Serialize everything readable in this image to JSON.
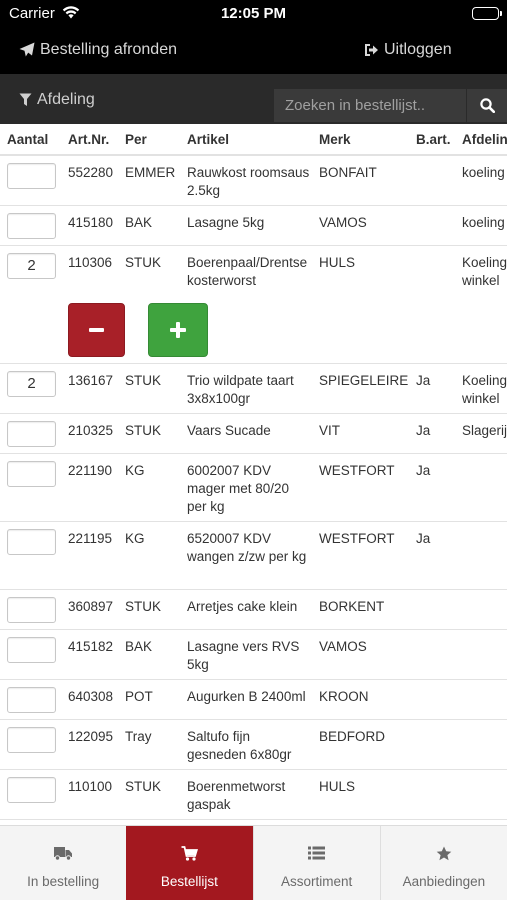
{
  "status_bar": {
    "carrier": "Carrier",
    "time": "12:05 PM"
  },
  "nav": {
    "finish_label": "Bestelling afronden",
    "logout_label": "Uitloggen"
  },
  "filter": {
    "department_label": "Afdeling",
    "search_placeholder": "Zoeken in bestellijst.."
  },
  "table": {
    "headers": {
      "aantal": "Aantal",
      "artnr": "Art.Nr.",
      "per": "Per",
      "artikel": "Artikel",
      "merk": "Merk",
      "bart": "B.art.",
      "afdeling": "Afdeling"
    },
    "rows": [
      {
        "qty": "",
        "artnr": "552280",
        "per": "EMMER",
        "artikel": "Rauwkost roomsaus 2.5kg",
        "merk": "BONFAIT",
        "bart": "",
        "afdeling": "koeling"
      },
      {
        "qty": "",
        "artnr": "415180",
        "per": "BAK",
        "artikel": "Lasagne 5kg",
        "merk": "VAMOS",
        "bart": "",
        "afdeling": "koeling"
      },
      {
        "qty": "2",
        "artnr": "110306",
        "per": "STUK",
        "artikel": "Boerenpaal/Drentse kosterworst",
        "merk": "HULS",
        "bart": "",
        "afdeling": "Koeling winkel"
      },
      {
        "qty": "2",
        "artnr": "136167",
        "per": "STUK",
        "artikel": "Trio wildpate taart 3x8x100gr",
        "merk": "SPIEGELEIRE",
        "bart": "Ja",
        "afdeling": "Koeling winkel"
      },
      {
        "qty": "",
        "artnr": "210325",
        "per": "STUK",
        "artikel": "Vaars Sucade",
        "merk": "VIT",
        "bart": "Ja",
        "afdeling": "Slagerij"
      },
      {
        "qty": "",
        "artnr": "221190",
        "per": "KG",
        "artikel": "6002007 KDV mager met 80/20 per kg",
        "merk": "WESTFORT",
        "bart": "Ja",
        "afdeling": ""
      },
      {
        "qty": "",
        "artnr": "221195",
        "per": "KG",
        "artikel": "6520007 KDV wangen z/zw per kg",
        "merk": "WESTFORT",
        "bart": "Ja",
        "afdeling": ""
      },
      {
        "qty": "",
        "artnr": "360897",
        "per": "STUK",
        "artikel": "Arretjes cake klein",
        "merk": "BORKENT",
        "bart": "",
        "afdeling": ""
      },
      {
        "qty": "",
        "artnr": "415182",
        "per": "BAK",
        "artikel": "Lasagne vers RVS 5kg",
        "merk": "VAMOS",
        "bart": "",
        "afdeling": ""
      },
      {
        "qty": "",
        "artnr": "640308",
        "per": "POT",
        "artikel": "Augurken B 2400ml",
        "merk": "KROON",
        "bart": "",
        "afdeling": ""
      },
      {
        "qty": "",
        "artnr": "122095",
        "per": "Tray",
        "artikel": "Saltufo fijn gesneden 6x80gr",
        "merk": "BEDFORD",
        "bart": "",
        "afdeling": ""
      },
      {
        "qty": "",
        "artnr": "110100",
        "per": "STUK",
        "artikel": "Boerenmetworst gaspak",
        "merk": "HULS",
        "bart": "",
        "afdeling": ""
      }
    ]
  },
  "tabs": [
    {
      "label": "In bestelling",
      "icon": "truck-icon",
      "active": false
    },
    {
      "label": "Bestellijst",
      "icon": "cart-icon",
      "active": true
    },
    {
      "label": "Assortiment",
      "icon": "list-icon",
      "active": false
    },
    {
      "label": "Aanbiedingen",
      "icon": "star-icon",
      "active": false
    }
  ],
  "colors": {
    "nav_bg": "#000000",
    "filter_bg": "#2a2a2a",
    "active_tab": "#a3181f",
    "minus_btn": "#a82028",
    "plus_btn": "#3fa33e"
  }
}
